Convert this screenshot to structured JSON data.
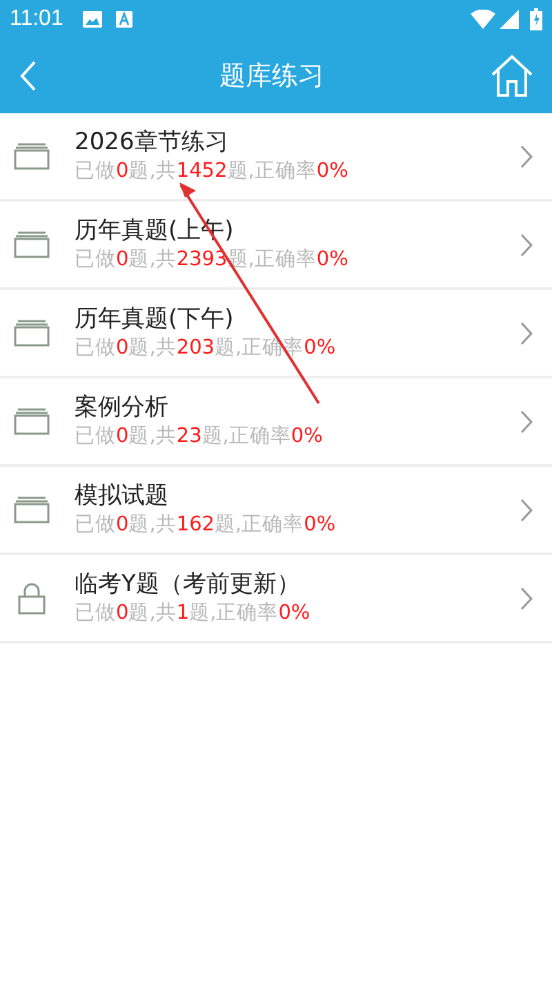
{
  "status_bar": {
    "time": "11:01"
  },
  "header": {
    "title": "题库练习"
  },
  "items": [
    {
      "kind": "folder",
      "title": "2026章节练习",
      "stats": [
        {
          "text": "已做",
          "kind": "label"
        },
        {
          "text": "0",
          "kind": "value"
        },
        {
          "text": "题,共",
          "kind": "label"
        },
        {
          "text": "1452",
          "kind": "value"
        },
        {
          "text": "题,正确率",
          "kind": "label"
        },
        {
          "text": "0%",
          "kind": "value"
        }
      ]
    },
    {
      "kind": "folder",
      "title": "历年真题(上午)",
      "stats": [
        {
          "text": "已做",
          "kind": "label"
        },
        {
          "text": "0",
          "kind": "value"
        },
        {
          "text": "题,共",
          "kind": "label"
        },
        {
          "text": "2393",
          "kind": "value"
        },
        {
          "text": "题,正确率",
          "kind": "label"
        },
        {
          "text": "0%",
          "kind": "value"
        }
      ]
    },
    {
      "kind": "folder",
      "title": "历年真题(下午)",
      "stats": [
        {
          "text": "已做",
          "kind": "label"
        },
        {
          "text": "0",
          "kind": "value"
        },
        {
          "text": "题,共",
          "kind": "label"
        },
        {
          "text": "203",
          "kind": "value"
        },
        {
          "text": "题,正确率",
          "kind": "label"
        },
        {
          "text": "0%",
          "kind": "value"
        }
      ]
    },
    {
      "kind": "folder",
      "title": "案例分析",
      "stats": [
        {
          "text": "已做",
          "kind": "label"
        },
        {
          "text": "0",
          "kind": "value"
        },
        {
          "text": "题,共",
          "kind": "label"
        },
        {
          "text": "23",
          "kind": "value"
        },
        {
          "text": "题,正确率",
          "kind": "label"
        },
        {
          "text": "0%",
          "kind": "value"
        }
      ]
    },
    {
      "kind": "folder",
      "title": "模拟试题",
      "stats": [
        {
          "text": "已做",
          "kind": "label"
        },
        {
          "text": "0",
          "kind": "value"
        },
        {
          "text": "题,共",
          "kind": "label"
        },
        {
          "text": "162",
          "kind": "value"
        },
        {
          "text": "题,正确率",
          "kind": "label"
        },
        {
          "text": "0%",
          "kind": "value"
        }
      ]
    },
    {
      "kind": "lock",
      "title": "临考Y题（考前更新）",
      "stats": [
        {
          "text": "已做",
          "kind": "label"
        },
        {
          "text": "0",
          "kind": "value"
        },
        {
          "text": "题,共",
          "kind": "label"
        },
        {
          "text": "1",
          "kind": "value"
        },
        {
          "text": "题,正确率",
          "kind": "label"
        },
        {
          "text": "0%",
          "kind": "value"
        }
      ]
    }
  ]
}
